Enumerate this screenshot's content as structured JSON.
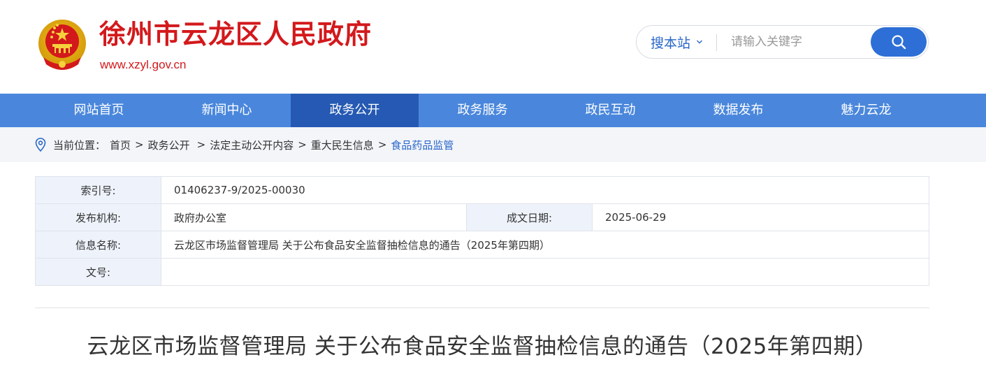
{
  "header": {
    "site_title": "徐州市云龙区人民政府",
    "site_url": "www.xzyl.gov.cn",
    "brand_color": "#d3191c"
  },
  "search": {
    "scope_label": "搜本站",
    "placeholder": "请输入关键字"
  },
  "nav": {
    "items": [
      {
        "label": "网站首页"
      },
      {
        "label": "新闻中心"
      },
      {
        "label": "政务公开",
        "active": true
      },
      {
        "label": "政务服务"
      },
      {
        "label": "政民互动"
      },
      {
        "label": "数据发布"
      },
      {
        "label": "魅力云龙"
      }
    ],
    "bg_color": "#4a87dc",
    "active_color": "#2559b3"
  },
  "breadcrumb": {
    "prefix": "当前位置：",
    "items": [
      "首页",
      "政务公开",
      "法定主动公开内容",
      "重大民生信息",
      "食品药品监管"
    ]
  },
  "info": {
    "index_label": "索引号:",
    "index_value": "01406237-9/2025-00030",
    "publisher_label": "发布机构:",
    "publisher_value": "政府办公室",
    "date_label": "成文日期:",
    "date_value": "2025-06-29",
    "name_label": "信息名称:",
    "name_value": "云龙区市场监督管理局 关于公布食品安全监督抽检信息的通告（2025年第四期）",
    "docno_label": "文号:",
    "docno_value": ""
  },
  "article": {
    "title": "云龙区市场监督管理局 关于公布食品安全监督抽检信息的通告（2025年第四期）"
  }
}
